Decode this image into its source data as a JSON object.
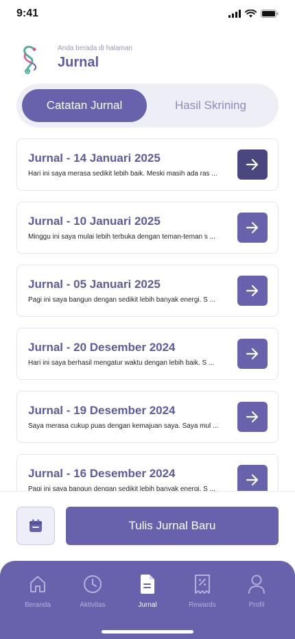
{
  "status_bar": {
    "time": "9:41",
    "icons": [
      "signal-icon",
      "wifi-icon",
      "battery-icon"
    ]
  },
  "header": {
    "subtitle": "Anda berada di halaman",
    "title": "Jurnal",
    "logo": "stethoscope-logo"
  },
  "tabs": [
    {
      "label": "Catatan Jurnal",
      "active": true
    },
    {
      "label": "Hasil Skrining",
      "active": false
    }
  ],
  "journals": [
    {
      "title": "Jurnal - 14 Januari 2025",
      "excerpt": "Hari ini saya merasa sedikit lebih baik. Meski masih ada ras ..."
    },
    {
      "title": "Jurnal - 10 Januari 2025",
      "excerpt": "Minggu ini saya mulai lebih terbuka dengan teman-teman s ..."
    },
    {
      "title": "Jurnal - 05 Januari 2025",
      "excerpt": "Pagi ini saya bangun dengan sedikit lebih banyak energi. S ..."
    },
    {
      "title": "Jurnal - 20 Desember 2024",
      "excerpt": "Hari ini saya berhasil mengatur waktu dengan lebih baik. S ..."
    },
    {
      "title": "Jurnal - 19 Desember 2024",
      "excerpt": "Saya merasa cukup puas dengan kemajuan saya. Saya mul ..."
    },
    {
      "title": "Jurnal - 16 Desember 2024",
      "excerpt": "Pagi ini saya bangun dengan sedikit lebih banyak energi. S ..."
    }
  ],
  "actions": {
    "new_journal_label": "Tulis Jurnal Baru",
    "calendar_icon": "calendar-icon"
  },
  "nav": [
    {
      "label": "Beranda",
      "icon": "home-icon",
      "active": false
    },
    {
      "label": "Aktivitas",
      "icon": "clock-icon",
      "active": false
    },
    {
      "label": "Jurnal",
      "icon": "document-icon",
      "active": true
    },
    {
      "label": "Rewards",
      "icon": "voucher-icon",
      "active": false
    },
    {
      "label": "Profil",
      "icon": "user-icon",
      "active": false
    }
  ],
  "colors": {
    "primary": "#6862AD",
    "primary_dark": "#4A467F",
    "tab_bg": "#EEEEF6",
    "title_text": "#5D5A9E"
  }
}
